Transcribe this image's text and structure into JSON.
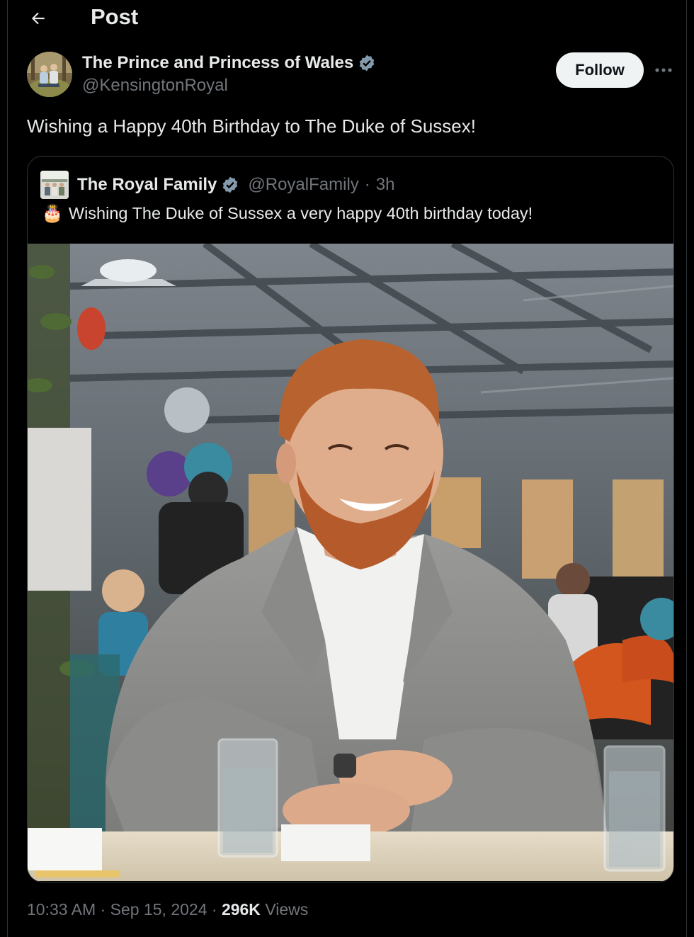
{
  "header": {
    "title": "Post",
    "back_icon": "arrow-left-icon"
  },
  "author": {
    "name": "The Prince and Princess of Wales",
    "handle": "@KensingtonRoyal",
    "verified_color": "#829aab",
    "follow_label": "Follow"
  },
  "tweet": {
    "text": "Wishing a Happy 40th Birthday to The Duke of Sussex!"
  },
  "quote": {
    "name": "The Royal Family",
    "handle": "@RoyalFamily",
    "separator": "·",
    "time": "3h",
    "emoji": "🎂",
    "text": "Wishing The Duke of Sussex a very happy 40th birthday today!"
  },
  "meta": {
    "time": "10:33 AM",
    "sep1": "·",
    "date": "Sep 15, 2024",
    "sep2": "·",
    "views_count": "296K",
    "views_label": "Views"
  },
  "colors": {
    "background": "#000000",
    "text": "#e7e9ea",
    "muted": "#71767b",
    "border": "#2f3336"
  }
}
